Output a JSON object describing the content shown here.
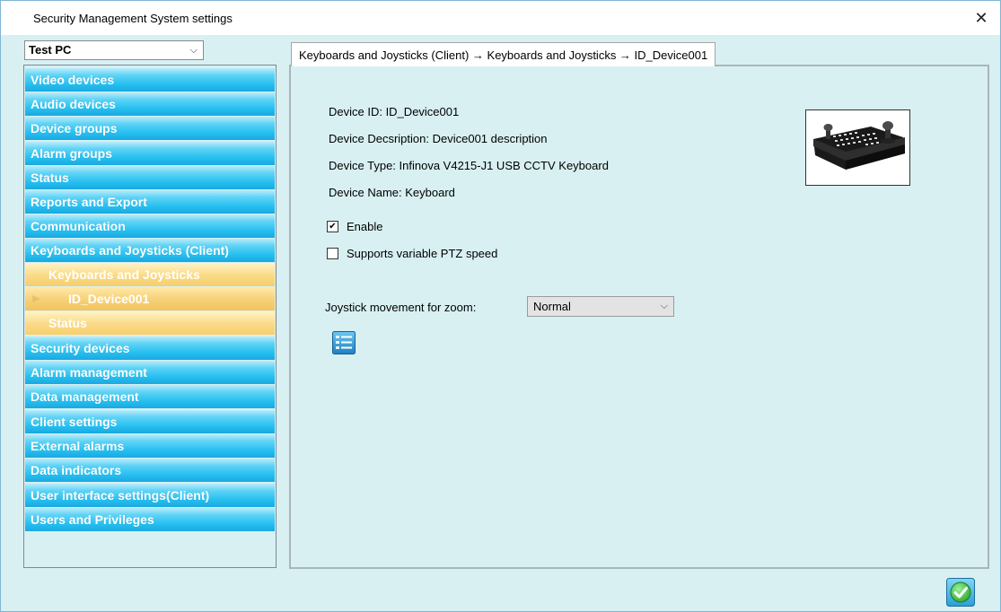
{
  "window": {
    "title": "Security Management System settings",
    "close_glyph": "✕"
  },
  "client_select": {
    "value": "Test PC",
    "chevron": "⌵"
  },
  "sidebar": {
    "items": [
      {
        "label": "Video devices"
      },
      {
        "label": "Audio devices"
      },
      {
        "label": "Device groups"
      },
      {
        "label": "Alarm groups"
      },
      {
        "label": "Status"
      },
      {
        "label": "Reports and Export"
      },
      {
        "label": "Communication"
      },
      {
        "label": "Keyboards and Joysticks (Client)"
      }
    ],
    "subitems": [
      {
        "label": "Keyboards and Joysticks"
      },
      {
        "label": "ID_Device001",
        "marker": "▶"
      },
      {
        "label": "Status"
      }
    ],
    "items_after": [
      {
        "label": "Security devices"
      },
      {
        "label": "Alarm management"
      },
      {
        "label": "Data management"
      },
      {
        "label": "Client settings"
      },
      {
        "label": "External alarms"
      },
      {
        "label": "Data indicators"
      },
      {
        "label": "User interface settings(Client)"
      },
      {
        "label": "Users and Privileges"
      }
    ]
  },
  "tab": {
    "label": "Keyboards and Joysticks (Client) → Keyboards and Joysticks → ID_Device001"
  },
  "device": {
    "id": "Device ID: ID_Device001",
    "description": "Device Decsription: Device001 description",
    "type": "Device Type: Infinova V4215-J1 USB CCTV Keyboard",
    "name": "Device Name: Keyboard"
  },
  "options": {
    "enable_label": "Enable",
    "enable_checked": true,
    "enable_mark": "✔",
    "ptz_label": "Supports variable PTZ speed",
    "ptz_checked": false
  },
  "zoom": {
    "label": "Joystick movement for zoom:",
    "value": "Normal",
    "chevron": "⌵"
  },
  "colors": {
    "nav_blue": "#25bff0",
    "nav_sub_yellow": "#f6cf6c",
    "panel_bg": "#d8f0f2",
    "ok_green": "#3fbf3f"
  },
  "icons": {
    "list_button": "list-settings-icon",
    "ok_button": "ok-check-icon",
    "device_image": "keyboard-joystick-image"
  }
}
